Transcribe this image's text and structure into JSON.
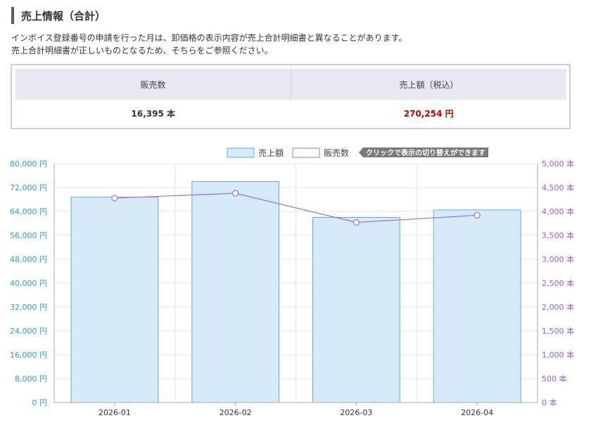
{
  "header": {
    "title": "売上情報（合計）"
  },
  "notes": [
    "インボイス登録番号の申請を行った月は、卸価格の表示内容が売上合計明細書と異なることがあります。",
    "売上合計明細書が正しいものとなるため、そちらをご参照ください。"
  ],
  "summary": {
    "qty_header": "販売数",
    "amount_header": "売上額（税込）",
    "qty_value": "16,395 本",
    "amount_value": "270,254 円"
  },
  "legend": {
    "sales_label": "売上額",
    "qty_label": "販売数",
    "toggle_tip": "クリックで表示の切り替えができます"
  },
  "colors": {
    "bar_fill": "#d6eaf8",
    "bar_stroke": "#5aaedd",
    "line": "#9b6fd8",
    "left_axis_text": "#2a9fd6",
    "right_axis_text": "#9a5bd6",
    "amount_text": "#c00000"
  },
  "chart_data": {
    "type": "bar",
    "categories": [
      "2026-01",
      "2026-02",
      "2026-03",
      "2026-04"
    ],
    "series": [
      {
        "name": "売上額",
        "type": "bar",
        "axis": "left",
        "values": [
          68800,
          74000,
          62000,
          64500
        ]
      },
      {
        "name": "販売数",
        "type": "line",
        "axis": "right",
        "values": [
          4280,
          4380,
          3770,
          3920
        ]
      }
    ],
    "left_axis": {
      "min": 0,
      "max": 80000,
      "ticks": [
        "0 円",
        "8,000 円",
        "16,000 円",
        "24,000 円",
        "32,000 円",
        "40,000 円",
        "48,000 円",
        "56,000 円",
        "64,000 円",
        "72,000 円",
        "80,000 円"
      ]
    },
    "right_axis": {
      "min": 0,
      "max": 5000,
      "ticks": [
        "0 本",
        "500 本",
        "1,000 本",
        "1,500 本",
        "2,000 本",
        "2,500 本",
        "3,000 本",
        "3,500 本",
        "4,000 本",
        "4,500 本",
        "5,000 本"
      ]
    },
    "grid": true,
    "legend_position": "top-right"
  }
}
